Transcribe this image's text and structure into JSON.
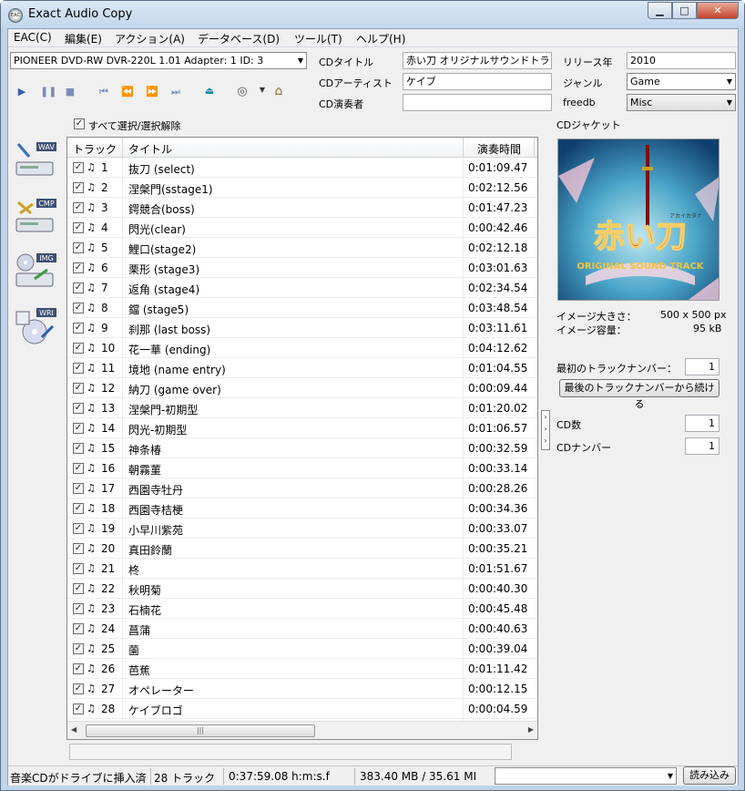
{
  "window": {
    "title": "Exact Audio Copy",
    "icon_text": "EAC"
  },
  "menu": [
    "EAC(C)",
    "編集(E)",
    "アクション(A)",
    "データベース(D)",
    "ツール(T)",
    "ヘルプ(H)"
  ],
  "drive": {
    "selected": "PIONEER DVD-RW  DVR-220L 1.01   Adapter: 1  ID: 3"
  },
  "cd_info": {
    "title_label": "CDタイトル",
    "title_value": "赤い刀 オリジナルサウンドトラック",
    "artist_label": "CDアーティスト",
    "artist_value": "ケイブ",
    "performer_label": "CD演奏者",
    "performer_value": "",
    "year_label": "リリース年",
    "year_value": "2010",
    "genre_label": "ジャンル",
    "genre_value": "Game",
    "freedb_label": "freedb",
    "freedb_value": "Misc"
  },
  "select_all_label": "すべて選択/選択解除",
  "side_icons": [
    "WAV",
    "CMP",
    "IMG",
    "WRI"
  ],
  "columns": {
    "track": "トラック",
    "title": "タイトル",
    "time": "演奏時間"
  },
  "tracks": [
    {
      "num": "1",
      "title": "抜刀 (select)",
      "time": "0:01:09.47"
    },
    {
      "num": "2",
      "title": "涅槃門(sstage1)",
      "time": "0:02:12.56"
    },
    {
      "num": "3",
      "title": "鍔競合(boss)",
      "time": "0:01:47.23"
    },
    {
      "num": "4",
      "title": "閃光(clear)",
      "time": "0:00:42.46"
    },
    {
      "num": "5",
      "title": "鯉口(stage2)",
      "time": "0:02:12.18"
    },
    {
      "num": "6",
      "title": "栗形 (stage3)",
      "time": "0:03:01.63"
    },
    {
      "num": "7",
      "title": "返角 (stage4)",
      "time": "0:02:34.54"
    },
    {
      "num": "8",
      "title": "鐺 (stage5)",
      "time": "0:03:48.54"
    },
    {
      "num": "9",
      "title": "刹那 (last boss)",
      "time": "0:03:11.61"
    },
    {
      "num": "10",
      "title": "花一華 (ending)",
      "time": "0:04:12.62"
    },
    {
      "num": "11",
      "title": "境地 (name entry)",
      "time": "0:01:04.55"
    },
    {
      "num": "12",
      "title": "納刀 (game over)",
      "time": "0:00:09.44"
    },
    {
      "num": "13",
      "title": "涅槃門-初期型",
      "time": "0:01:20.02"
    },
    {
      "num": "14",
      "title": "閃光-初期型",
      "time": "0:01:06.57"
    },
    {
      "num": "15",
      "title": "神条椿",
      "time": "0:00:32.59"
    },
    {
      "num": "16",
      "title": "朝霧菫",
      "time": "0:00:33.14"
    },
    {
      "num": "17",
      "title": "西園寺牡丹",
      "time": "0:00:28.26"
    },
    {
      "num": "18",
      "title": "西園寺桔梗",
      "time": "0:00:34.36"
    },
    {
      "num": "19",
      "title": "小早川紫苑",
      "time": "0:00:33.07"
    },
    {
      "num": "20",
      "title": "真田鈴蘭",
      "time": "0:00:35.21"
    },
    {
      "num": "21",
      "title": "柊",
      "time": "0:01:51.67"
    },
    {
      "num": "22",
      "title": "秋明菊",
      "time": "0:00:40.30"
    },
    {
      "num": "23",
      "title": "石楠花",
      "time": "0:00:45.48"
    },
    {
      "num": "24",
      "title": "菖蒲",
      "time": "0:00:40.63"
    },
    {
      "num": "25",
      "title": "薗",
      "time": "0:00:39.04"
    },
    {
      "num": "26",
      "title": "芭蕉",
      "time": "0:01:11.42"
    },
    {
      "num": "27",
      "title": "オペレーター",
      "time": "0:00:12.15"
    },
    {
      "num": "28",
      "title": "ケイブロゴ",
      "time": "0:00:04.59"
    }
  ],
  "jacket": {
    "label": "CDジャケット",
    "art_title": "赤い刀",
    "art_ruby": "アカイカタナ",
    "art_subtitle": "ORIGINAL SOUND TRACK",
    "size_label": "イメージ大きさ：",
    "size_value": "500 x 500 px",
    "capacity_label": "イメージ容量：",
    "capacity_value": "95 kB"
  },
  "first_track": {
    "label": "最初のトラックナンバー：",
    "value": "1"
  },
  "continue_button": "最後のトラックナンバーから続ける",
  "cd_count": {
    "label": "CD数",
    "value": "1"
  },
  "cd_number": {
    "label": "CDナンバー",
    "value": "1"
  },
  "status": {
    "message": "音楽CDがドライブに挿入済",
    "tracks": "28 トラック",
    "length": "0:37:59.08 h:m:s.f",
    "size": "383.40 MB / 35.61 MI",
    "load_button": "読み込み"
  }
}
